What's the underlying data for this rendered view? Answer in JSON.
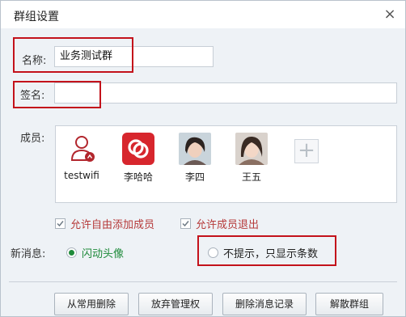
{
  "window": {
    "title": "群组设置",
    "close_glyph": "×"
  },
  "name_field": {
    "label": "名称:",
    "value": "业务测试群"
  },
  "sign_field": {
    "label": "签名:",
    "value": ""
  },
  "members": {
    "label": "成员:",
    "list": [
      {
        "name": "testwifi",
        "icon": "user-outline-icon"
      },
      {
        "name": "李哈哈",
        "icon": "red-link-avatar-icon"
      },
      {
        "name": "李四",
        "icon": "portrait-avatar-icon"
      },
      {
        "name": "王五",
        "icon": "portrait-avatar-icon"
      }
    ],
    "add_glyph": "+"
  },
  "options": {
    "allow_add": {
      "label": "允许自由添加成员",
      "checked": true
    },
    "allow_quit": {
      "label": "允许成员退出",
      "checked": true
    }
  },
  "new_message": {
    "label": "新消息:",
    "flash": {
      "label": "闪动头像",
      "selected": true
    },
    "silent": {
      "label": "不提示，只显示条数",
      "selected": false
    }
  },
  "buttons": {
    "remove_common": "从常用删除",
    "give_up_admin": "放弃管理权",
    "delete_history": "删除消息记录",
    "dissolve": "解散群组"
  },
  "colors": {
    "highlight": "#c3121b",
    "accent_green": "#1e8a3a",
    "option_text": "#b63a3a"
  }
}
